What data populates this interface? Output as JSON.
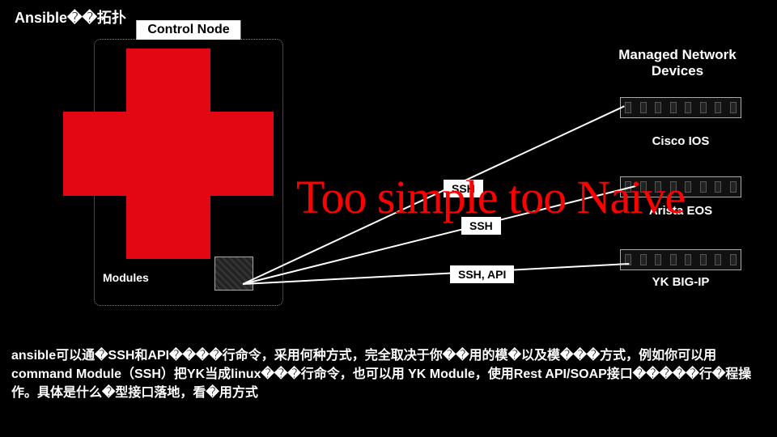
{
  "title": "Ansible��拓扑",
  "control_node": {
    "label": "Control Node",
    "modules_label": "Modules"
  },
  "managed_label": "Managed Network Devices",
  "devices": [
    {
      "label": "Cisco IOS"
    },
    {
      "label": "Arista EOS"
    },
    {
      "label": "YK BIG-IP"
    }
  ],
  "connections": [
    {
      "label": "SSH"
    },
    {
      "label": "SSH"
    },
    {
      "label": "SSH, API"
    }
  ],
  "overlay": "Too simple too Naive",
  "footer": "ansible可以通�SSH和API����行命令，采用何种方式，完全取决于你��用的模�以及模���方式，例如你可以用command Module（SSH）把YK当成linux���行命令，也可以用 YK Module，使用Rest API/SOAP接口�����行�程操作。具体是什么�型接口落地，看�用方式"
}
